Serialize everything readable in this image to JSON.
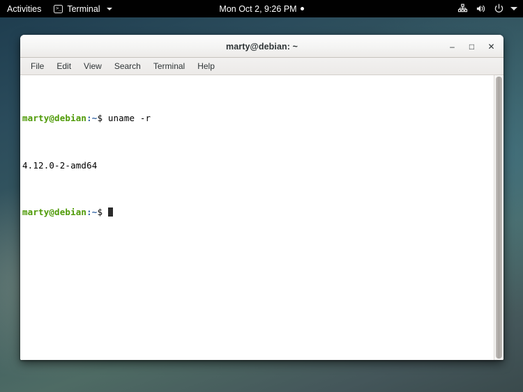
{
  "topbar": {
    "activities_label": "Activities",
    "app_menu": {
      "icon": "terminal-icon",
      "icon_glyph": ">_",
      "label": "Terminal",
      "caret": "chevron-down-icon"
    },
    "clock": {
      "text": "Mon Oct  2,  9:26 PM",
      "notification_dot": true
    },
    "status_icons": [
      {
        "name": "network-icon",
        "title": "Wired Network"
      },
      {
        "name": "volume-icon",
        "title": "Volume"
      },
      {
        "name": "power-icon",
        "title": "Power"
      },
      {
        "name": "chevron-down-icon",
        "title": "System Menu"
      }
    ],
    "background_color": "#010101",
    "text_color": "#ffffff"
  },
  "window": {
    "title": "marty@debian: ~",
    "controls": {
      "minimize": "–",
      "maximize": "□",
      "close": "✕"
    },
    "menubar": [
      {
        "label": "File"
      },
      {
        "label": "Edit"
      },
      {
        "label": "View"
      },
      {
        "label": "Search"
      },
      {
        "label": "Terminal"
      },
      {
        "label": "Help"
      }
    ]
  },
  "terminal": {
    "prompt_user": "marty@debian",
    "prompt_path": ":~",
    "prompt_symbol": "$",
    "lines": [
      {
        "type": "prompt",
        "user": "marty@debian",
        "path": ":~",
        "symbol": "$",
        "command": " uname -r"
      },
      {
        "type": "output",
        "text": "4.12.0-2-amd64"
      },
      {
        "type": "prompt",
        "user": "marty@debian",
        "path": ":~",
        "symbol": "$",
        "command": " ",
        "cursor": true
      }
    ],
    "colors": {
      "background": "#ffffff",
      "foreground": "#000000",
      "user_green": "#4e9a06",
      "path_blue": "#3465a4",
      "cursor": "#2b2b2b"
    }
  },
  "desktop": {
    "wallpaper_colors": [
      "#1d3b4d",
      "#2b4c5c",
      "#3a5b60",
      "#4e6b64",
      "#3a4a4c"
    ]
  }
}
